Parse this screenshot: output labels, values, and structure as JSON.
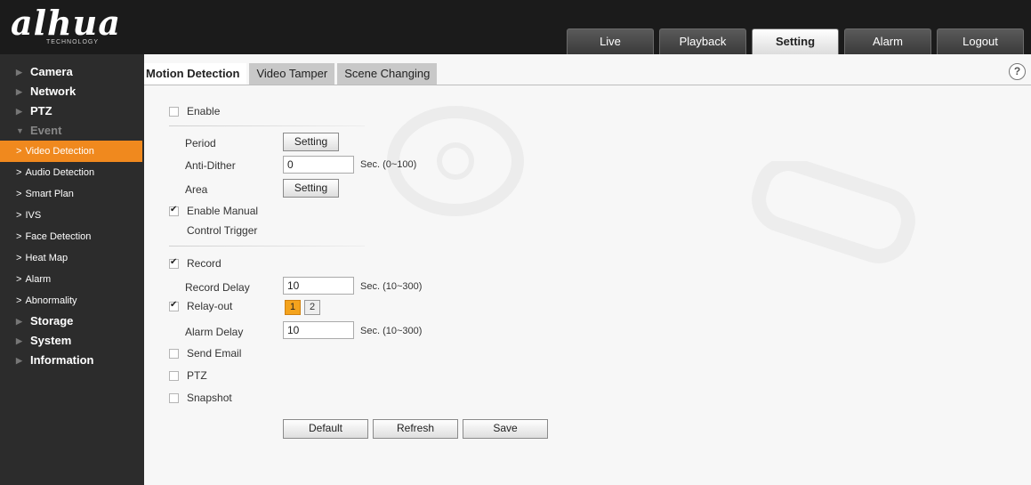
{
  "header": {
    "logo": "alhua",
    "logo_sub": "TECHNOLOGY",
    "tabs": [
      {
        "label": "Live"
      },
      {
        "label": "Playback"
      },
      {
        "label": "Setting",
        "active": true
      },
      {
        "label": "Alarm"
      },
      {
        "label": "Logout"
      }
    ]
  },
  "sidebar": {
    "groups": [
      {
        "label": "Camera"
      },
      {
        "label": "Network"
      },
      {
        "label": "PTZ"
      },
      {
        "label": "Event",
        "open": true
      }
    ],
    "event_items": [
      {
        "label": "Video Detection",
        "active": true
      },
      {
        "label": "Audio Detection"
      },
      {
        "label": "Smart Plan"
      },
      {
        "label": "IVS"
      },
      {
        "label": "Face Detection"
      },
      {
        "label": "Heat Map"
      },
      {
        "label": "Alarm"
      },
      {
        "label": "Abnormality"
      }
    ],
    "groups_after": [
      {
        "label": "Storage"
      },
      {
        "label": "System"
      },
      {
        "label": "Information"
      }
    ]
  },
  "main": {
    "subtabs": [
      {
        "label": "Motion Detection",
        "active": true
      },
      {
        "label": "Video Tamper"
      },
      {
        "label": "Scene Changing"
      }
    ],
    "help_icon": "?",
    "enable_label": "Enable",
    "enable_checked": false,
    "period_label": "Period",
    "period_button": "Setting",
    "anti_dither_label": "Anti-Dither",
    "anti_dither_value": "0",
    "anti_dither_hint": "Sec. (0~100)",
    "area_label": "Area",
    "area_button": "Setting",
    "manual_trigger_label_1": "Enable Manual",
    "manual_trigger_label_2": "Control Trigger",
    "manual_trigger_checked": true,
    "record_label": "Record",
    "record_checked": true,
    "record_delay_label": "Record Delay",
    "record_delay_value": "10",
    "record_delay_hint": "Sec. (10~300)",
    "relay_out_label": "Relay-out",
    "relay_out_checked": true,
    "relay_channels": [
      {
        "label": "1",
        "on": true
      },
      {
        "label": "2",
        "on": false
      }
    ],
    "alarm_delay_label": "Alarm Delay",
    "alarm_delay_value": "10",
    "alarm_delay_hint": "Sec. (10~300)",
    "send_email_label": "Send Email",
    "send_email_checked": false,
    "ptz_label": "PTZ",
    "ptz_checked": false,
    "snapshot_label": "Snapshot",
    "snapshot_checked": false,
    "default_button": "Default",
    "refresh_button": "Refresh",
    "save_button": "Save"
  },
  "colors": {
    "header_bg": "#1b1b1b",
    "sidebar_bg": "#2c2c2c",
    "active_orange": "#f0891e",
    "channel_on": "#f4a31d"
  }
}
